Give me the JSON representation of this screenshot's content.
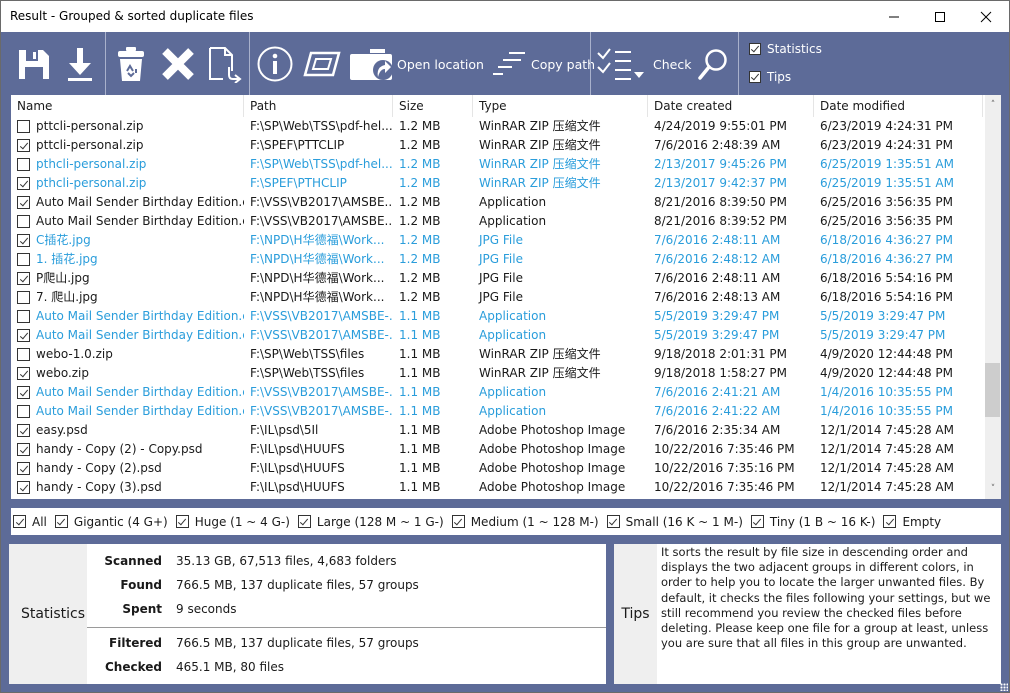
{
  "window": {
    "title": "Result - Grouped & sorted duplicate files",
    "controls": {
      "minimize": "—",
      "maximize": "☐",
      "close": "✕"
    }
  },
  "toolbar": {
    "buttons": [
      {
        "name": "save",
        "icon": "floppy-disk-icon",
        "label": ""
      },
      {
        "name": "export",
        "icon": "download-icon",
        "label": ""
      },
      {
        "name": "recycle",
        "icon": "recycle-bin-icon",
        "label": ""
      },
      {
        "name": "delete",
        "icon": "x-delete-icon",
        "label": ""
      },
      {
        "name": "move",
        "icon": "file-move-icon",
        "label": ""
      },
      {
        "name": "properties",
        "icon": "info-icon",
        "label": ""
      },
      {
        "name": "preview",
        "icon": "preview-window-icon",
        "label": ""
      },
      {
        "name": "open-location",
        "icon": "folder-open-icon",
        "label": "Open location"
      },
      {
        "name": "copy-path",
        "icon": "copy-path-icon",
        "label": "Copy path"
      },
      {
        "name": "check",
        "icon": "checklist-icon",
        "label": "Check"
      },
      {
        "name": "search",
        "icon": "search-icon",
        "label": ""
      }
    ],
    "toggles": [
      {
        "label": "Statistics",
        "checked": true
      },
      {
        "label": "Tips",
        "checked": true
      }
    ]
  },
  "colors": {
    "accent_blue_group": "#2a9ddb",
    "frame": "#5d6b98"
  },
  "list": {
    "columns": [
      "Name",
      "Path",
      "Size",
      "Type",
      "Date created",
      "Date modified"
    ],
    "rows": [
      {
        "checked": false,
        "group_color": "black",
        "name": "pttcli-personal.zip",
        "path": "F:\\SP\\Web\\TSS\\pdf-hel...",
        "size": "1.2 MB",
        "type": "WinRAR ZIP 压缩文件",
        "created": "4/24/2019 9:55:01 PM",
        "modified": "6/23/2019 4:24:31 PM"
      },
      {
        "checked": true,
        "group_color": "black",
        "name": "pttcli-personal.zip",
        "path": "F:\\SPEF\\PTTCLIP",
        "size": "1.2 MB",
        "type": "WinRAR ZIP 压缩文件",
        "created": "7/6/2016 2:48:39 AM",
        "modified": "6/23/2019 4:24:31 PM"
      },
      {
        "checked": false,
        "group_color": "blue",
        "name": "pthcli-personal.zip",
        "path": "F:\\SP\\Web\\TSS\\pdf-hel...",
        "size": "1.2 MB",
        "type": "WinRAR ZIP 压缩文件",
        "created": "2/13/2017 9:45:26 PM",
        "modified": "6/25/2019 1:35:51 AM"
      },
      {
        "checked": true,
        "group_color": "blue",
        "name": "pthcli-personal.zip",
        "path": "F:\\SPEF\\PTHCLIP",
        "size": "1.2 MB",
        "type": "WinRAR ZIP 压缩文件",
        "created": "2/13/2017 9:42:37 PM",
        "modified": "6/25/2019 1:35:51 AM"
      },
      {
        "checked": true,
        "group_color": "black",
        "name": "Auto Mail Sender Birthday Edition.exe",
        "path": "F:\\VSS\\VB2017\\AMSBE...",
        "size": "1.2 MB",
        "type": "Application",
        "created": "8/21/2016 8:39:50 PM",
        "modified": "6/25/2016 3:56:35 PM"
      },
      {
        "checked": false,
        "group_color": "black",
        "name": "Auto Mail Sender Birthday Edition.exe",
        "path": "F:\\VSS\\VB2017\\AMSBE...",
        "size": "1.2 MB",
        "type": "Application",
        "created": "8/21/2016 8:39:52 PM",
        "modified": "6/25/2016 3:56:35 PM"
      },
      {
        "checked": true,
        "group_color": "blue",
        "name": "C插花.jpg",
        "path": "F:\\NPD\\H华德福\\Work...",
        "size": "1.2 MB",
        "type": "JPG File",
        "created": "7/6/2016 2:48:11 AM",
        "modified": "6/18/2016 4:36:27 PM"
      },
      {
        "checked": false,
        "group_color": "blue",
        "name": "1. 插花.jpg",
        "path": "F:\\NPD\\H华德福\\Work...",
        "size": "1.2 MB",
        "type": "JPG File",
        "created": "7/6/2016 2:48:12 AM",
        "modified": "6/18/2016 4:36:27 PM"
      },
      {
        "checked": true,
        "group_color": "black",
        "name": "P爬山.jpg",
        "path": "F:\\NPD\\H华德福\\Work...",
        "size": "1.2 MB",
        "type": "JPG File",
        "created": "7/6/2016 2:48:11 AM",
        "modified": "6/18/2016 5:54:16 PM"
      },
      {
        "checked": false,
        "group_color": "black",
        "name": "7. 爬山.jpg",
        "path": "F:\\NPD\\H华德福\\Work...",
        "size": "1.2 MB",
        "type": "JPG File",
        "created": "7/6/2016 2:48:13 AM",
        "modified": "6/18/2016 5:54:16 PM"
      },
      {
        "checked": false,
        "group_color": "blue",
        "name": "Auto Mail Sender Birthday Edition.exe",
        "path": "F:\\VSS\\VB2017\\AMSBE-...",
        "size": "1.1 MB",
        "type": "Application",
        "created": "5/5/2019 3:29:47 PM",
        "modified": "5/5/2019 3:29:47 PM"
      },
      {
        "checked": true,
        "group_color": "blue",
        "name": "Auto Mail Sender Birthday Edition.exe",
        "path": "F:\\VSS\\VB2017\\AMSBE-...",
        "size": "1.1 MB",
        "type": "Application",
        "created": "5/5/2019 3:29:47 PM",
        "modified": "5/5/2019 3:29:47 PM"
      },
      {
        "checked": false,
        "group_color": "black",
        "name": "webo-1.0.zip",
        "path": "F:\\SP\\Web\\TSS\\files",
        "size": "1.1 MB",
        "type": "WinRAR ZIP 压缩文件",
        "created": "9/18/2018 2:01:31 PM",
        "modified": "4/9/2020 12:44:48 PM"
      },
      {
        "checked": true,
        "group_color": "black",
        "name": "webo.zip",
        "path": "F:\\SP\\Web\\TSS\\files",
        "size": "1.1 MB",
        "type": "WinRAR ZIP 压缩文件",
        "created": "9/18/2018 1:58:27 PM",
        "modified": "4/9/2020 12:44:48 PM"
      },
      {
        "checked": true,
        "group_color": "blue",
        "name": "Auto Mail Sender Birthday Edition.exe",
        "path": "F:\\VSS\\VB2017\\AMSBE-...",
        "size": "1.1 MB",
        "type": "Application",
        "created": "7/6/2016 2:41:21 AM",
        "modified": "1/4/2016 10:35:55 PM"
      },
      {
        "checked": false,
        "group_color": "blue",
        "name": "Auto Mail Sender Birthday Edition.exe",
        "path": "F:\\VSS\\VB2017\\AMSBE-...",
        "size": "1.1 MB",
        "type": "Application",
        "created": "7/6/2016 2:41:22 AM",
        "modified": "1/4/2016 10:35:55 PM"
      },
      {
        "checked": true,
        "group_color": "black",
        "name": "easy.psd",
        "path": "F:\\IL\\psd\\5Il",
        "size": "1.1 MB",
        "type": "Adobe Photoshop Image",
        "created": "7/6/2016 2:35:34 AM",
        "modified": "12/1/2014 7:45:28 AM"
      },
      {
        "checked": true,
        "group_color": "black",
        "name": "handy - Copy (2) - Copy.psd",
        "path": "F:\\IL\\psd\\HUUFS",
        "size": "1.1 MB",
        "type": "Adobe Photoshop Image",
        "created": "10/22/2016 7:35:46 PM",
        "modified": "12/1/2014 7:45:28 AM"
      },
      {
        "checked": true,
        "group_color": "black",
        "name": "handy - Copy (2).psd",
        "path": "F:\\IL\\psd\\HUUFS",
        "size": "1.1 MB",
        "type": "Adobe Photoshop Image",
        "created": "10/22/2016 7:35:16 PM",
        "modified": "12/1/2014 7:45:28 AM"
      },
      {
        "checked": true,
        "group_color": "black",
        "name": "handy - Copy (3).psd",
        "path": "F:\\IL\\psd\\HUUFS",
        "size": "1.1 MB",
        "type": "Adobe Photoshop Image",
        "created": "10/22/2016 7:35:46 PM",
        "modified": "12/1/2014 7:45:28 AM"
      }
    ],
    "scroll": {
      "up": "˄",
      "down": "˅"
    }
  },
  "filters": [
    {
      "label": "All",
      "checked": true
    },
    {
      "label": "Gigantic (4 G+)",
      "checked": true
    },
    {
      "label": "Huge (1 ~ 4 G-)",
      "checked": true
    },
    {
      "label": "Large (128 M ~ 1 G-)",
      "checked": true
    },
    {
      "label": "Medium (1 ~ 128 M-)",
      "checked": true
    },
    {
      "label": "Small (16 K ~ 1 M-)",
      "checked": true
    },
    {
      "label": "Tiny (1 B ~ 16 K-)",
      "checked": true
    },
    {
      "label": "Empty",
      "checked": true
    }
  ],
  "statistics": {
    "title": "Statistics",
    "items": [
      {
        "key": "Scanned",
        "value": "35.13 GB, 67,513 files, 4,683 folders"
      },
      {
        "key": "Found",
        "value": "766.5 MB, 137 duplicate files, 57 groups"
      },
      {
        "key": "Spent",
        "value": "9 seconds"
      },
      {
        "key": "Filtered",
        "value": "766.5 MB, 137 duplicate files, 57 groups"
      },
      {
        "key": "Checked",
        "value": "465.1 MB, 80 files"
      }
    ]
  },
  "tips": {
    "title": "Tips",
    "text": "It sorts the result by file size in descending order and displays the two adjacent groups in different colors, in order to help you to locate the larger unwanted files. By default, it checks the files following your settings, but we still recommend you review the checked files before deleting. Please keep one file for a group at least, unless you are sure that all files in this group are unwanted."
  }
}
